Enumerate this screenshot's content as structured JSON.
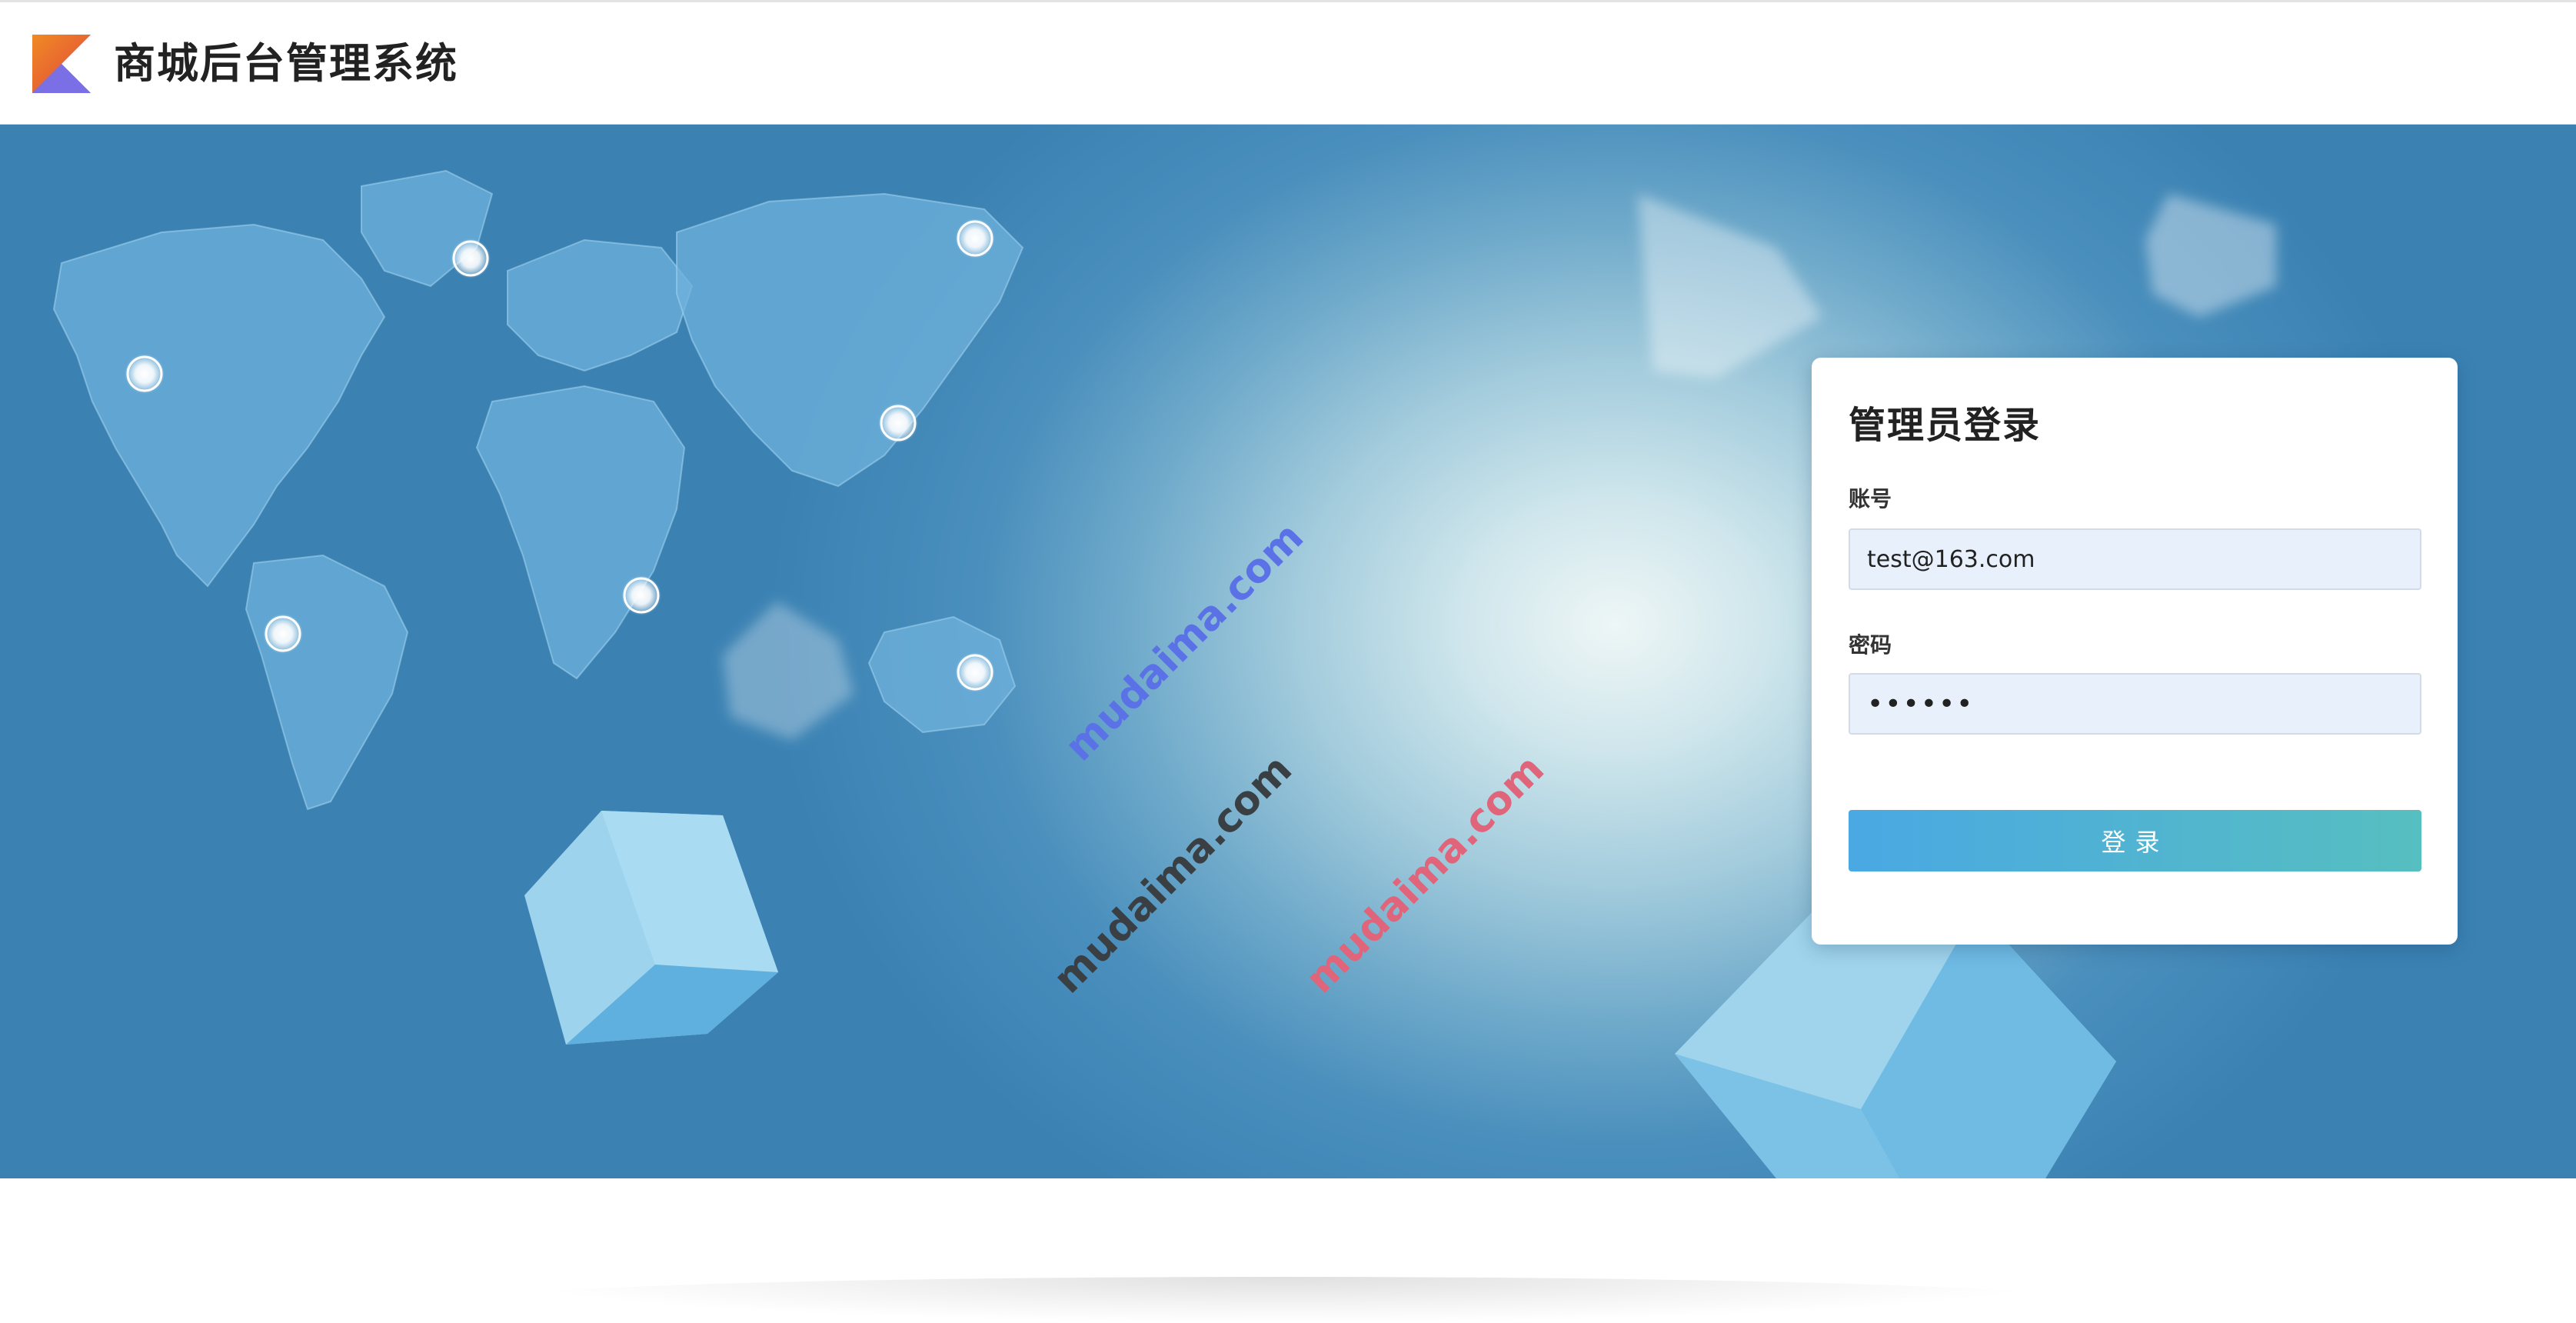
{
  "header": {
    "app_title": "商城后台管理系统",
    "logo_icon": "kotlin-k-logo-icon"
  },
  "banner": {
    "watermarks": [
      "mudaima.com",
      "mudaima.com",
      "mudaima.com"
    ],
    "watermark_colors": [
      "#5a72e6",
      "#3a3f44",
      "#e0657a"
    ]
  },
  "login": {
    "title": "管理员登录",
    "account_label": "账号",
    "account_value": "test@163.com",
    "password_label": "密码",
    "password_value": "123456",
    "submit_label": "登录"
  },
  "colors": {
    "button_start": "#4aa8e3",
    "button_end": "#56bfc0",
    "input_bg": "#e8f0fc",
    "banner_blue": "#3b82b3"
  }
}
